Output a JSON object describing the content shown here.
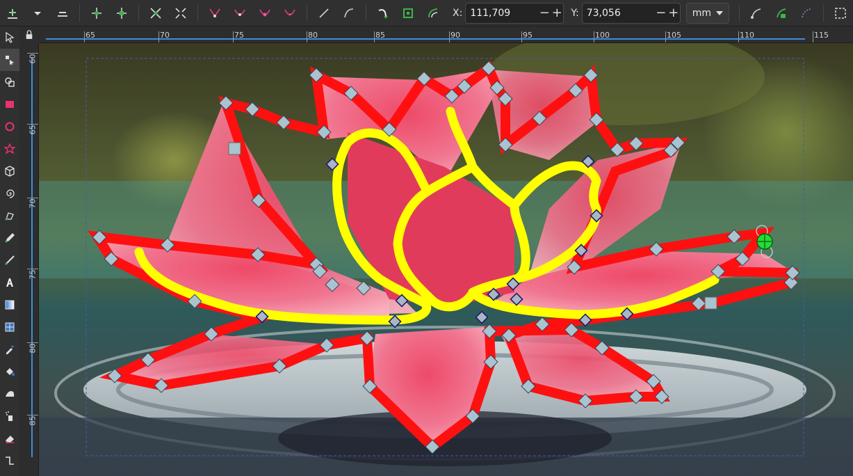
{
  "toolbar": {
    "x_label": "X:",
    "x_value": "111,709",
    "y_label": "Y:",
    "y_value": "73,056",
    "stepper_minus": "−",
    "stepper_plus": "+",
    "unit": "mm"
  },
  "rulers": {
    "horizontal": [
      "65",
      "70",
      "75",
      "80",
      "85",
      "90",
      "95",
      "100",
      "105",
      "110",
      "115"
    ],
    "vertical": [
      "60",
      "65",
      "70",
      "75",
      "80",
      "85"
    ]
  },
  "colors": {
    "outline_path": "#ff1010",
    "inner_path": "#ffff00",
    "node_fill": "#a9c3cf",
    "selected_node": "#22dd33"
  }
}
